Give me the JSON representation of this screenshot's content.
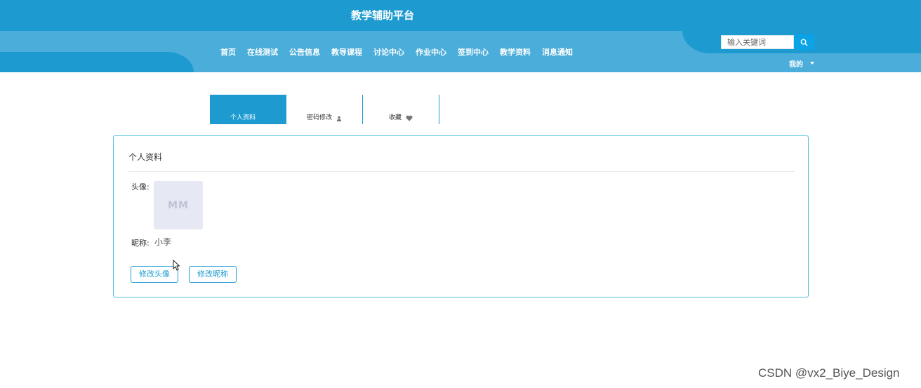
{
  "header": {
    "title": "教学辅助平台",
    "nav": [
      "首页",
      "在线测试",
      "公告信息",
      "教导课程",
      "讨论中心",
      "作业中心",
      "签到中心",
      "教学资料",
      "消息通知"
    ],
    "search_placeholder": "输入关键词",
    "user_menu_label": "我的",
    "colors": {
      "primary": "#1d9bd0",
      "band": "#4aadda",
      "search_button": "#0aa3e6"
    }
  },
  "tabs": [
    {
      "label": "个人资料",
      "icon": "pencil-icon",
      "active": true
    },
    {
      "label": "密码修改",
      "icon": "user-icon",
      "active": false
    },
    {
      "label": "收藏",
      "icon": "heart-icon",
      "active": false
    }
  ],
  "profile": {
    "title": "个人资料",
    "avatar_label": "头像:",
    "avatar_placeholder": "MM",
    "nickname_label": "昵称:",
    "nickname_value": "小李",
    "change_avatar_button": "修改头像",
    "change_nickname_button": "修改昵称"
  },
  "watermark": "CSDN @vx2_Biye_Design"
}
